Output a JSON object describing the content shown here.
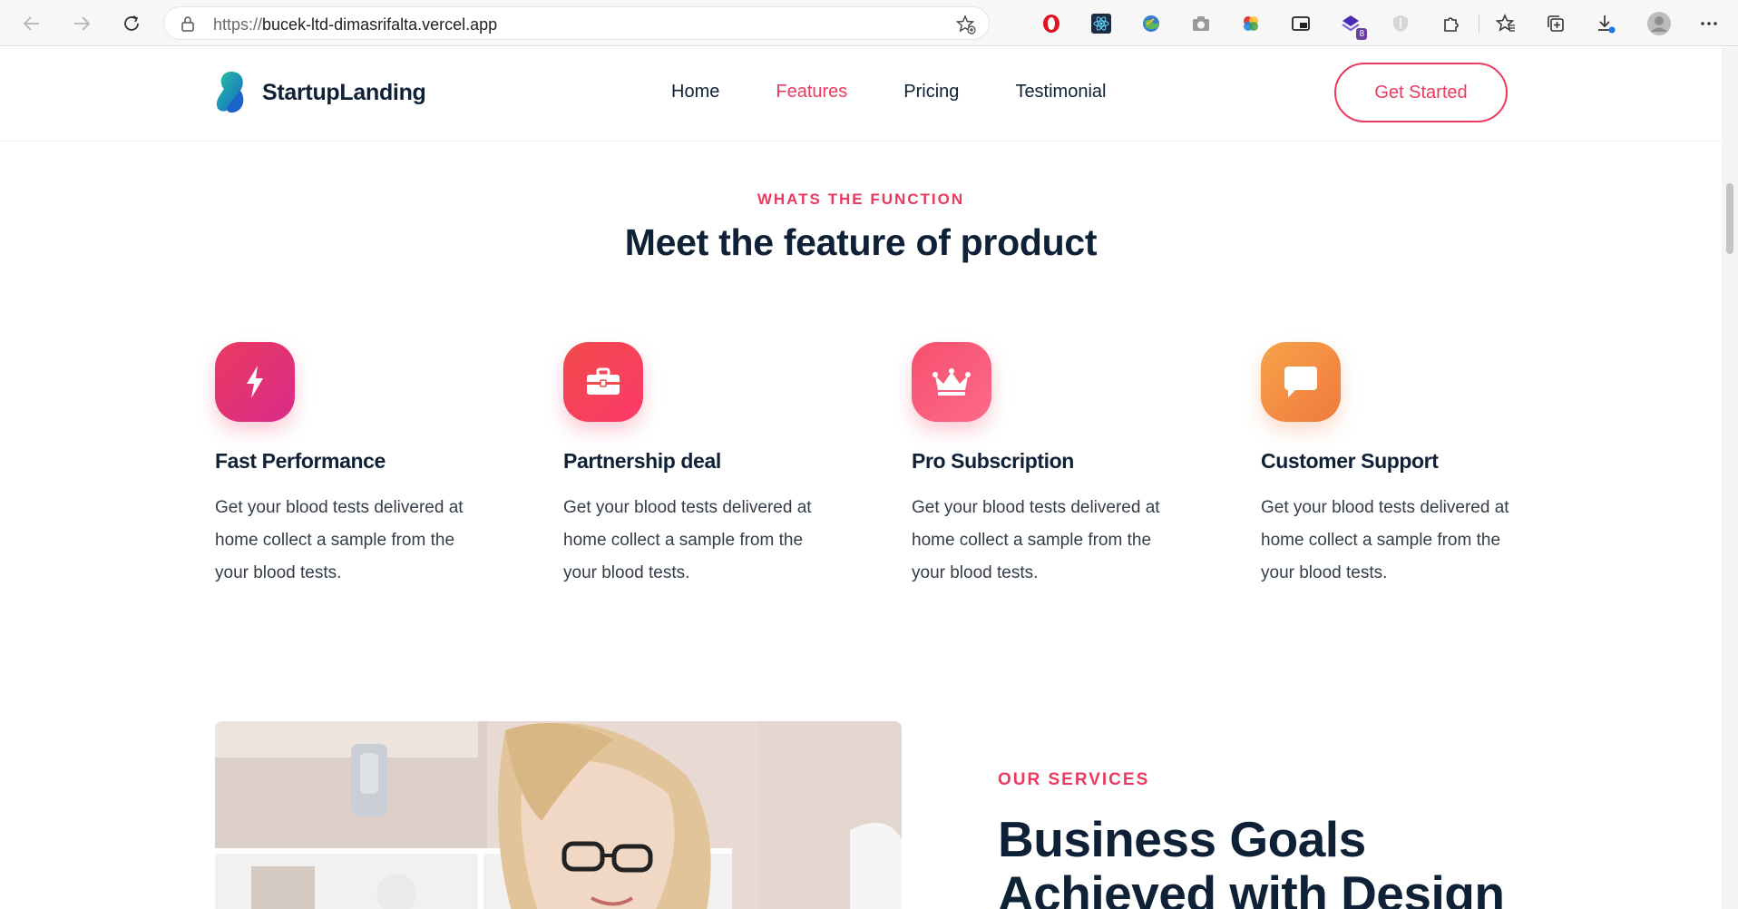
{
  "browser": {
    "url_protocol": "https://",
    "url_host": "bucek-ltd-dimasrifalta.vercel.app",
    "extension_badge": "8"
  },
  "header": {
    "brand": "StartupLanding",
    "menu": [
      {
        "label": "Home",
        "active": false
      },
      {
        "label": "Features",
        "active": true
      },
      {
        "label": "Pricing",
        "active": false
      },
      {
        "label": "Testimonial",
        "active": false
      }
    ],
    "cta_label": "Get Started"
  },
  "features_section": {
    "kicker": "WHATS THE FUNCTION",
    "title": "Meet the feature of product",
    "items": [
      {
        "icon": "lightning-icon",
        "title": "Fast Performance",
        "description": "Get your blood tests delivered at home collect a sample from the your blood tests."
      },
      {
        "icon": "briefcase-icon",
        "title": "Partnership deal",
        "description": "Get your blood tests delivered at home collect a sample from the your blood tests."
      },
      {
        "icon": "crown-icon",
        "title": "Pro Subscription",
        "description": "Get your blood tests delivered at home collect a sample from the your blood tests."
      },
      {
        "icon": "chat-icon",
        "title": "Customer Support",
        "description": "Get your blood tests delivered at home collect a sample from the your blood tests."
      }
    ]
  },
  "services_section": {
    "kicker": "OUR SERVICES",
    "title": "Business Goals Achieved with Design"
  },
  "colors": {
    "accent": "#ea3a60",
    "heading": "#0f2137",
    "body_text": "#343d48"
  }
}
